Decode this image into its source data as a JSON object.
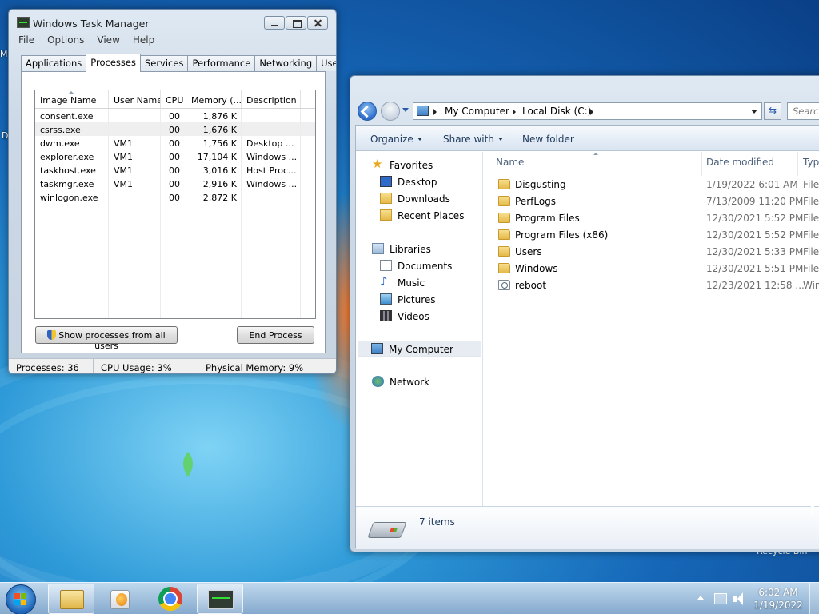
{
  "desktop": {
    "fragment_left_1": "M",
    "fragment_left_2": "D",
    "fragment_bottom_right": "Recycle Bin"
  },
  "taskmgr": {
    "title": "Windows Task Manager",
    "menu": [
      "File",
      "Options",
      "View",
      "Help"
    ],
    "tabs": [
      "Applications",
      "Processes",
      "Services",
      "Performance",
      "Networking",
      "Users"
    ],
    "active_tab": "Processes",
    "columns": [
      "Image Name",
      "User Name",
      "CPU",
      "Memory (...",
      "Description"
    ],
    "processes": [
      {
        "image": "consent.exe",
        "user": "",
        "cpu": "00",
        "memory": "1,876 K",
        "desc": ""
      },
      {
        "image": "csrss.exe",
        "user": "",
        "cpu": "00",
        "memory": "1,676 K",
        "desc": ""
      },
      {
        "image": "dwm.exe",
        "user": "VM1",
        "cpu": "00",
        "memory": "1,756 K",
        "desc": "Desktop ..."
      },
      {
        "image": "explorer.exe",
        "user": "VM1",
        "cpu": "00",
        "memory": "17,104 K",
        "desc": "Windows ..."
      },
      {
        "image": "taskhost.exe",
        "user": "VM1",
        "cpu": "00",
        "memory": "3,016 K",
        "desc": "Host Proc..."
      },
      {
        "image": "taskmgr.exe",
        "user": "VM1",
        "cpu": "00",
        "memory": "2,916 K",
        "desc": "Windows ..."
      },
      {
        "image": "winlogon.exe",
        "user": "",
        "cpu": "00",
        "memory": "2,872 K",
        "desc": ""
      }
    ],
    "show_all_button": "Show processes from all users",
    "end_process_button": "End Process",
    "status": {
      "processes": "Processes: 36",
      "cpu": "CPU Usage: 3%",
      "memory": "Physical Memory: 9%"
    }
  },
  "explorer": {
    "breadcrumb": [
      "My Computer",
      "Local Disk (C:)"
    ],
    "search_placeholder": "Search",
    "toolbar": {
      "organize": "Organize",
      "share": "Share with",
      "new_folder": "New folder"
    },
    "nav": {
      "favorites": "Favorites",
      "desktop": "Desktop",
      "downloads": "Downloads",
      "recent": "Recent Places",
      "libraries": "Libraries",
      "documents": "Documents",
      "music": "Music",
      "pictures": "Pictures",
      "videos": "Videos",
      "computer": "My Computer",
      "network": "Network"
    },
    "columns": {
      "name": "Name",
      "date": "Date modified",
      "type": "Type"
    },
    "files": [
      {
        "name": "Disgusting",
        "date": "1/19/2022 6:01 AM",
        "type": "File f"
      },
      {
        "name": "PerfLogs",
        "date": "7/13/2009 11:20 PM",
        "type": "File f"
      },
      {
        "name": "Program Files",
        "date": "12/30/2021 5:52 PM",
        "type": "File f"
      },
      {
        "name": "Program Files (x86)",
        "date": "12/30/2021 5:52 PM",
        "type": "File f"
      },
      {
        "name": "Users",
        "date": "12/30/2021 5:33 PM",
        "type": "File f"
      },
      {
        "name": "Windows",
        "date": "12/30/2021 5:51 PM",
        "type": "File f"
      },
      {
        "name": "reboot",
        "date": "12/23/2021 12:58 ...",
        "type": "Wind"
      }
    ],
    "item_count": "7 items"
  },
  "taskbar": {
    "time": "6:02 AM",
    "date": "1/19/2022"
  },
  "colors": {
    "desktop_blue": "#1667b8",
    "link_text": "#1e395b"
  }
}
